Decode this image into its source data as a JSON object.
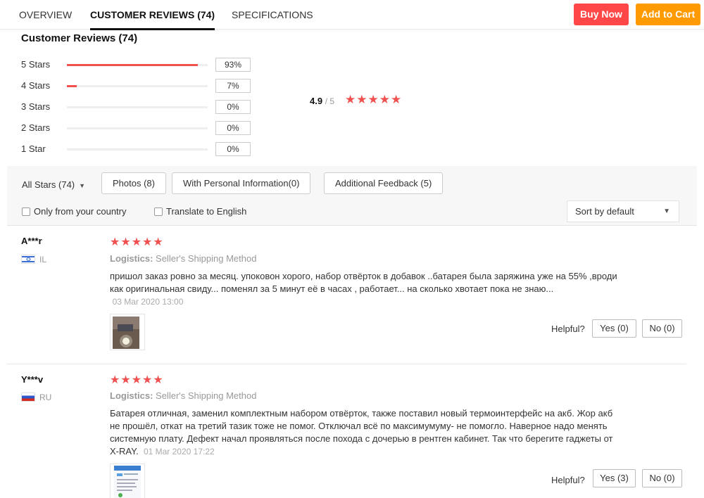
{
  "tabs": {
    "overview": "OVERVIEW",
    "reviews": "CUSTOMER REVIEWS (74)",
    "specifications": "SPECIFICATIONS"
  },
  "actions": {
    "buy_now": "Buy Now",
    "add_to_cart": "Add to Cart"
  },
  "summary": {
    "title": "Customer Reviews (74)",
    "rows": [
      {
        "label": "5 Stars",
        "percent": "93%",
        "fill": 0.93
      },
      {
        "label": "4 Stars",
        "percent": "7%",
        "fill": 0.07
      },
      {
        "label": "3 Stars",
        "percent": "0%",
        "fill": 0
      },
      {
        "label": "2 Stars",
        "percent": "0%",
        "fill": 0
      },
      {
        "label": "1 Star",
        "percent": "0%",
        "fill": 0
      }
    ],
    "average": "4.9",
    "out_of": "/ 5",
    "stars": "★★★★★"
  },
  "filters": {
    "all_stars": "All Stars (74)",
    "photos": "Photos (8)",
    "personal_info": "With Personal Information(0)",
    "additional_feedback": "Additional Feedback (5)",
    "only_country": "Only from your country",
    "translate": "Translate to English",
    "sort": "Sort by default"
  },
  "reviews": [
    {
      "name": "A***r",
      "country": "IL",
      "stars": "★★★★★",
      "logistics_label": "Logistics:",
      "logistics_value": "Seller's Shipping Method",
      "text": "пришол заказ ровно за месяц. упоковон хорого, набор отвёрток в добавок ..батарея была заряжина уже на 55% ,вроди как оригинальная свиду... поменял за 5 минут её в часах , работает... на сколько хвотает пока не знаю...",
      "date": "03 Mar 2020 13:00",
      "helpful": "Helpful?",
      "yes": "Yes (0)",
      "no": "No (0)"
    },
    {
      "name": "Y***v",
      "country": "RU",
      "stars": "★★★★★",
      "logistics_label": "Logistics:",
      "logistics_value": "Seller's Shipping Method",
      "text": "Батарея отличная, заменил комплектным набором отвёрток, также поставил новый термоинтерфейс на акб. Жор акб не прошёл, откат на третий тазик тоже не помог. Отключал всё по максимумуму- не помогло. Наверное надо менять системную плату. Дефект начал проявляться после похода с дочерью в рентген кабинет. Так что берегите гаджеты от X-RAY.",
      "date": "01 Mar 2020 17:22",
      "helpful": "Helpful?",
      "yes": "Yes (3)",
      "no": "No (0)"
    }
  ],
  "colors": {
    "star_red": "#f0504f",
    "buy_now": "#ff4747",
    "add_to_cart": "#ff9a00"
  }
}
